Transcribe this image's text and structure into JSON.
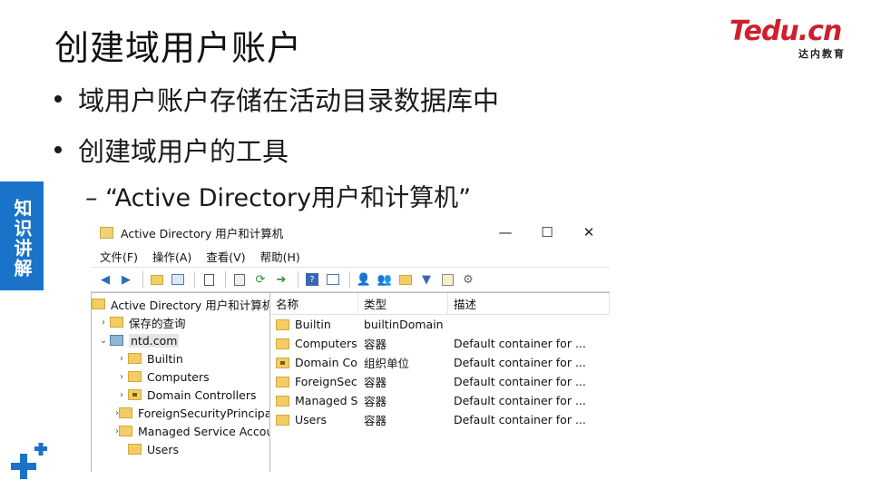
{
  "slide": {
    "title": "创建域用户账户",
    "bullets": [
      "域用户账户存储在活动目录数据库中",
      "创建域用户的工具"
    ],
    "sub_bullet": "– “Active Directory用户和计算机”",
    "side_tab": "知识讲解"
  },
  "logo": {
    "main": "Tedu.cn",
    "sub": "达内教育",
    "color": "#cf1f2e"
  },
  "window": {
    "title": "Active Directory 用户和计算机",
    "controls": [
      "—",
      "☐",
      "✕"
    ],
    "menu": [
      "文件(F)",
      "操作(A)",
      "查看(V)",
      "帮助(H)"
    ],
    "tree": {
      "root": "Active Directory 用户和计算机",
      "saved_queries": "保存的查询",
      "domain": "ntd.com",
      "children": [
        "Builtin",
        "Computers",
        "Domain Controllers",
        "ForeignSecurityPrincipals",
        "Managed Service Accounts",
        "Users"
      ]
    },
    "list": {
      "columns": [
        "名称",
        "类型",
        "描述"
      ],
      "rows": [
        {
          "name": "Builtin",
          "type": "builtinDomain",
          "desc": ""
        },
        {
          "name": "Computers",
          "type": "容器",
          "desc": "Default container for ..."
        },
        {
          "name": "Domain Co...",
          "type": "组织单位",
          "desc": "Default container for ..."
        },
        {
          "name": "ForeignSec...",
          "type": "容器",
          "desc": "Default container for ..."
        },
        {
          "name": "Managed S...",
          "type": "容器",
          "desc": "Default container for ..."
        },
        {
          "name": "Users",
          "type": "容器",
          "desc": "Default container for ..."
        }
      ]
    }
  },
  "colors": {
    "accent_blue": "#1a73c8",
    "folder": "#f3cd63"
  }
}
